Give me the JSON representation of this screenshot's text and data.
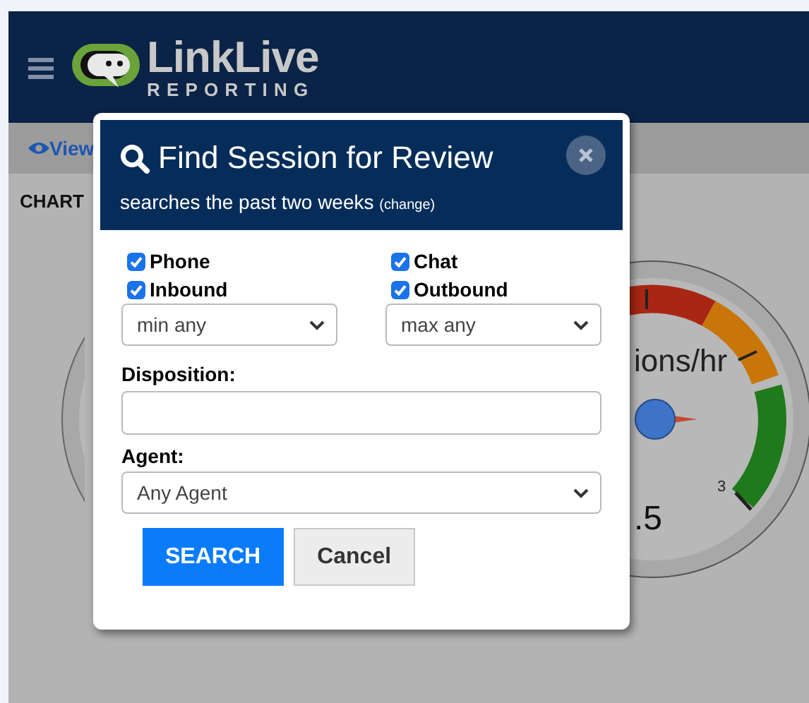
{
  "header": {
    "logo_name": "LinkLive",
    "logo_tagline": "REPORTING"
  },
  "nav": {
    "link": "View"
  },
  "content": {
    "section_label": "CHART",
    "gauge": {
      "unit_label": "ions/hr",
      "tick_label": "3",
      "value": ".5"
    }
  },
  "dialog": {
    "title": "Find Session for Review",
    "subtitle": "searches the past two weeks",
    "change_link": "(change)",
    "checkboxes": [
      {
        "label": "Phone",
        "checked": true
      },
      {
        "label": "Chat",
        "checked": true
      },
      {
        "label": "Inbound",
        "checked": true
      },
      {
        "label": "Outbound",
        "checked": true
      }
    ],
    "min_select": "min any",
    "max_select": "max any",
    "disposition": {
      "label": "Disposition:"
    },
    "agent": {
      "label": "Agent:",
      "value": "Any Agent"
    },
    "buttons": [
      {
        "label": "SEARCH",
        "kind": "primary"
      },
      {
        "label": "Cancel",
        "kind": "secondary"
      }
    ]
  }
}
